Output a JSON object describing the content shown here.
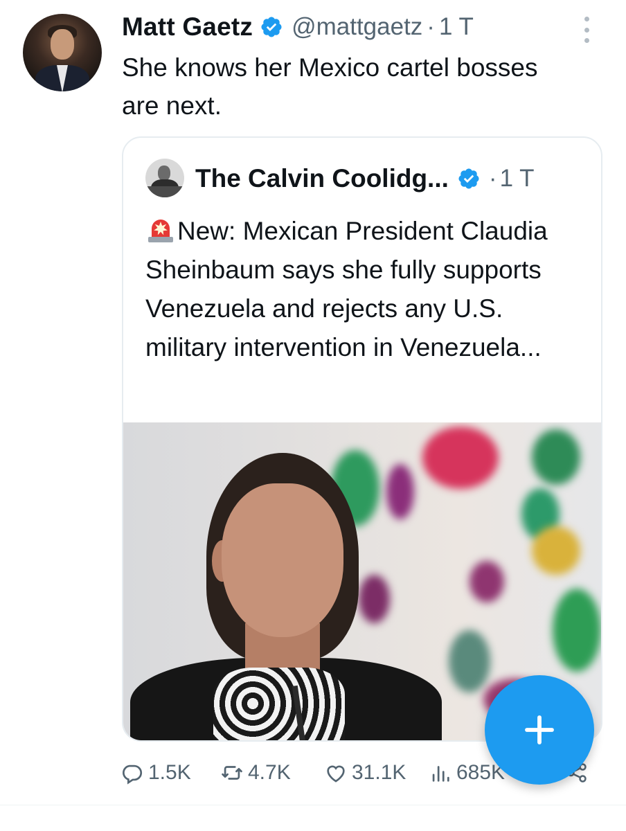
{
  "tweet": {
    "author_name": "Matt Gaetz",
    "handle": "@mattgaetz",
    "separator": "·",
    "time": "1 T",
    "text": "She knows her Mexico cartel bosses are next."
  },
  "quoted_tweet": {
    "author_name": "The Calvin Coolidg...",
    "separator": "·",
    "time": "1 T",
    "siren_emoji": "siren-emoji",
    "text": "New: Mexican President Claudia Sheinbaum says she fully supports Venezuela and rejects any U.S. military intervention in Venezuela..."
  },
  "actions": {
    "replies": "1.5K",
    "retweets": "4.7K",
    "likes": "31.1K",
    "views": "685K"
  },
  "fab": {
    "icon": "plus-icon"
  },
  "colors": {
    "accent": "#1d9bf0",
    "text_primary": "#0f1419",
    "text_secondary": "#536471",
    "verified": "#1d9bf0"
  }
}
